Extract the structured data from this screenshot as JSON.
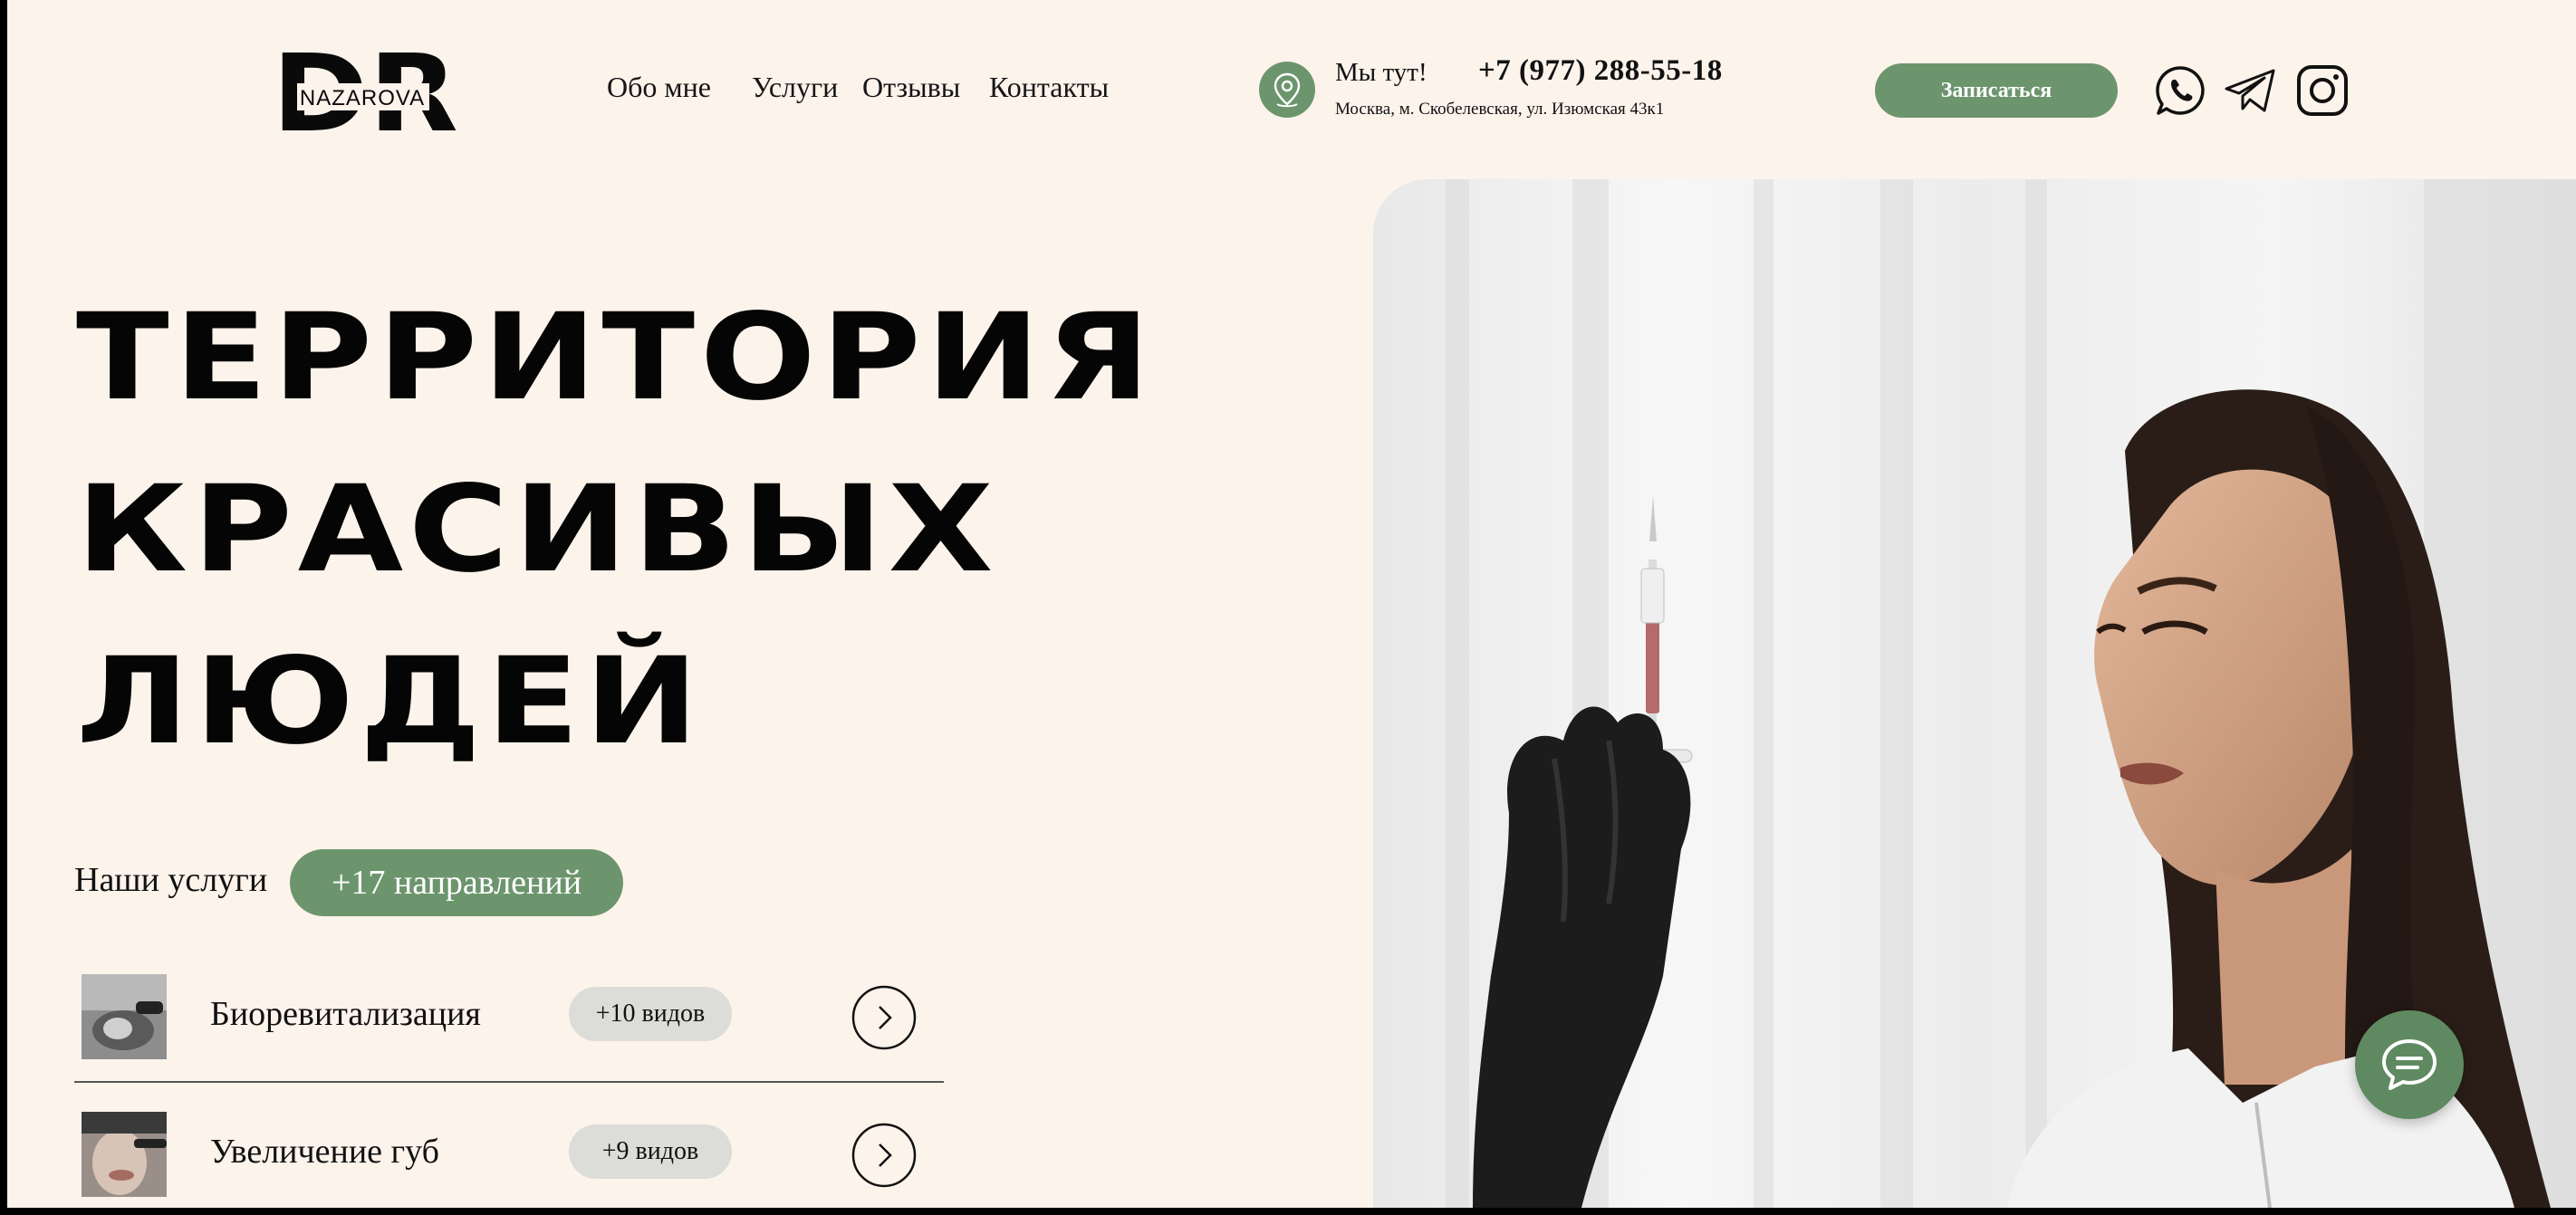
{
  "brand": {
    "logo_letters": "DR",
    "logo_name": "NAZAROVA",
    "accent_color": "#6c956d",
    "background_color": "#fcf3eb"
  },
  "nav": {
    "items": [
      {
        "label": "Обо мне"
      },
      {
        "label": "Услуги"
      },
      {
        "label": "Отзывы"
      },
      {
        "label": "Контакты"
      }
    ]
  },
  "contact": {
    "location_label": "Мы тут!",
    "phone": "+7 (977) 288-55-18",
    "address": "Москва, м. Скобелевская, ул. Изюмская 43к1",
    "location_icon": "map-pin-icon"
  },
  "header": {
    "book_button": "Записаться"
  },
  "social": [
    {
      "icon": "whatsapp-icon"
    },
    {
      "icon": "telegram-icon"
    },
    {
      "icon": "instagram-icon"
    }
  ],
  "hero": {
    "title_lines": [
      "ТЕРРИТОРИЯ",
      "КРАСИВЫХ",
      "ЛЮДЕЙ"
    ]
  },
  "services": {
    "label": "Наши услуги",
    "directions_pill": "+17 направлений",
    "items": [
      {
        "name": "Биоревитализация",
        "count": "+10 видов",
        "icon": "chevron-right-icon"
      },
      {
        "name": "Увеличение губ",
        "count": "+9 видов",
        "icon": "chevron-right-icon"
      }
    ]
  },
  "chat": {
    "icon": "chat-bubble-icon"
  }
}
